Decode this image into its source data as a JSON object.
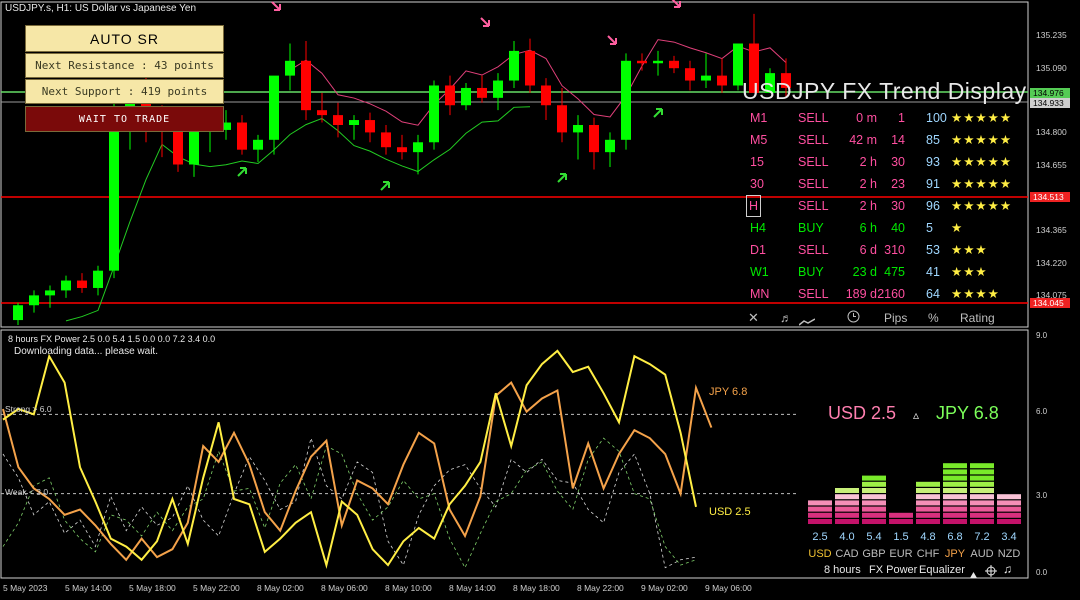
{
  "window": {
    "title": "USDJPY.s, H1:  US Dollar vs Japanese Yen"
  },
  "sr_panel": {
    "title": "AUTO SR",
    "resistance": "Next Resistance : 43 points",
    "support": "Next Support : 419 points",
    "status": "WAIT TO TRADE"
  },
  "price_axis": {
    "ticks": [
      "135.235",
      "135.090",
      "134.800",
      "134.655",
      "134.365",
      "134.220",
      "134.075"
    ],
    "bid": "134.976",
    "ask": "134.933",
    "support_level": "134.513",
    "low_level": "134.045"
  },
  "trend_display": {
    "title": "USDJPY FX Trend Display",
    "rows": [
      {
        "tf": "M1",
        "signal": "SELL",
        "time": "0 m",
        "pips": "1",
        "pct": "100",
        "stars": "★★★★★"
      },
      {
        "tf": "M5",
        "signal": "SELL",
        "time": "42 m",
        "pips": "14",
        "pct": "85",
        "stars": "★★★★★"
      },
      {
        "tf": "15",
        "signal": "SELL",
        "time": "2 h",
        "pips": "30",
        "pct": "93",
        "stars": "★★★★★"
      },
      {
        "tf": "30",
        "signal": "SELL",
        "time": "2 h",
        "pips": "23",
        "pct": "91",
        "stars": "★★★★★"
      },
      {
        "tf": "H",
        "signal": "SELL",
        "time": "2 h",
        "pips": "30",
        "pct": "96",
        "stars": "★★★★★"
      },
      {
        "tf": "H4",
        "signal": "BUY",
        "time": "6 h",
        "pips": "40",
        "pct": "5",
        "stars": "★"
      },
      {
        "tf": "D1",
        "signal": "SELL",
        "time": "6 d",
        "pips": "310",
        "pct": "53",
        "stars": "★★★"
      },
      {
        "tf": "W1",
        "signal": "BUY",
        "time": "23 d",
        "pips": "475",
        "pct": "41",
        "stars": "★★★"
      },
      {
        "tf": "MN",
        "signal": "SELL",
        "time": "189 d",
        "pips": "2160",
        "pct": "64",
        "stars": "★★★★"
      }
    ],
    "footer": {
      "close": "✕",
      "sound": "♬",
      "pips": "Pips",
      "percent": "%",
      "rating": "Rating"
    }
  },
  "power_panel": {
    "header": "8 hours FX Power 2.5 0.0 5.4 1.5 0.0 0.0 7.2 3.4 0.0",
    "status": "Downloading data... please wait.",
    "strong_label": "Strong > 6.0",
    "weak_label": "Weak < 3.0",
    "jpy_label": "JPY 6.8",
    "usd_label": "USD 2.5",
    "pair_usd": "USD 2.5",
    "pair_arrow": "▵",
    "pair_jpy": "JPY 6.8",
    "axis_ticks": [
      "9.0",
      "6.0",
      "3.0",
      "0.0"
    ]
  },
  "equalizer": {
    "currencies": [
      {
        "name": "USD",
        "value": "2.5",
        "level": 2.5,
        "name_color": "#f1c232"
      },
      {
        "name": "CAD",
        "value": "4.0",
        "level": 4.0,
        "name_color": "#bdbdbd"
      },
      {
        "name": "GBP",
        "value": "5.4",
        "level": 5.4,
        "name_color": "#bdbdbd"
      },
      {
        "name": "EUR",
        "value": "1.5",
        "level": 1.5,
        "name_color": "#bdbdbd"
      },
      {
        "name": "CHF",
        "value": "4.8",
        "level": 4.8,
        "name_color": "#bdbdbd"
      },
      {
        "name": "JPY",
        "value": "6.8",
        "level": 6.8,
        "name_color": "#f4a24a"
      },
      {
        "name": "AUD",
        "value": "7.2",
        "level": 7.2,
        "name_color": "#bdbdbd"
      },
      {
        "name": "NZD",
        "value": "3.4",
        "level": 3.4,
        "name_color": "#bdbdbd"
      }
    ],
    "footer_hours": "8 hours",
    "footer_power": "FX Power",
    "footer_eq": "Equalizer"
  },
  "time_axis": [
    "5 May 2023",
    "5 May 14:00",
    "5 May 18:00",
    "5 May 22:00",
    "8 May 02:00",
    "8 May 06:00",
    "8 May 10:00",
    "8 May 14:00",
    "8 May 18:00",
    "8 May 22:00",
    "9 May 02:00",
    "9 May 06:00"
  ],
  "colors": {
    "bull": "#00ff00",
    "bear": "#ff0000",
    "pink": "#ff4fa0",
    "sell": "#ff4fa0",
    "buy": "#00e800",
    "usd": "#ffee44",
    "jpy": "#f4a24a",
    "support": "#ff0000",
    "bidline": "#66dd66"
  },
  "chart_data": {
    "type": "candlestick",
    "timeframe": "H1",
    "symbol": "USDJPY.s",
    "ylim": [
      134.03,
      135.33
    ],
    "candles": [
      [
        134.05,
        134.12,
        134.03,
        134.11
      ],
      [
        134.11,
        134.17,
        134.08,
        134.15
      ],
      [
        134.15,
        134.19,
        134.1,
        134.17
      ],
      [
        134.17,
        134.23,
        134.14,
        134.21
      ],
      [
        134.21,
        134.24,
        134.16,
        134.18
      ],
      [
        134.18,
        134.27,
        134.15,
        134.25
      ],
      [
        134.25,
        134.93,
        134.22,
        134.88
      ],
      [
        134.88,
        134.99,
        134.74,
        134.94
      ],
      [
        134.94,
        135.05,
        134.77,
        134.86
      ],
      [
        134.86,
        134.92,
        134.71,
        134.82
      ],
      [
        134.82,
        134.86,
        134.65,
        134.68
      ],
      [
        134.68,
        134.83,
        134.63,
        134.82
      ],
      [
        134.82,
        134.86,
        134.73,
        134.82
      ],
      [
        134.82,
        134.9,
        134.78,
        134.85
      ],
      [
        134.85,
        134.88,
        134.72,
        134.74
      ],
      [
        134.74,
        134.8,
        134.69,
        134.78
      ],
      [
        134.78,
        134.95,
        134.72,
        135.04
      ],
      [
        135.04,
        135.17,
        134.98,
        135.1
      ],
      [
        135.1,
        135.18,
        134.86,
        134.9
      ],
      [
        134.9,
        134.97,
        134.85,
        134.88
      ],
      [
        134.88,
        134.93,
        134.79,
        134.84
      ],
      [
        134.84,
        134.88,
        134.78,
        134.86
      ],
      [
        134.86,
        134.89,
        134.77,
        134.81
      ],
      [
        134.81,
        134.84,
        134.72,
        134.75
      ],
      [
        134.75,
        134.8,
        134.7,
        134.73
      ],
      [
        134.73,
        134.8,
        134.64,
        134.77
      ],
      [
        134.77,
        135.02,
        134.74,
        135.0
      ],
      [
        135.0,
        135.04,
        134.88,
        134.92
      ],
      [
        134.92,
        135.01,
        134.9,
        134.99
      ],
      [
        134.99,
        135.04,
        134.93,
        134.95
      ],
      [
        134.95,
        135.05,
        134.9,
        135.02
      ],
      [
        135.02,
        135.18,
        134.99,
        135.14
      ],
      [
        135.14,
        135.19,
        134.97,
        135.0
      ],
      [
        135.0,
        135.03,
        134.86,
        134.92
      ],
      [
        134.92,
        134.99,
        134.77,
        134.81
      ],
      [
        134.81,
        134.88,
        134.7,
        134.84
      ],
      [
        134.84,
        134.87,
        134.66,
        134.73
      ],
      [
        134.73,
        134.81,
        134.67,
        134.78
      ],
      [
        134.78,
        135.13,
        134.74,
        135.1
      ],
      [
        135.1,
        135.13,
        135.06,
        135.09
      ],
      [
        135.09,
        135.14,
        135.04,
        135.1
      ],
      [
        135.1,
        135.12,
        135.05,
        135.07
      ],
      [
        135.07,
        135.1,
        134.98,
        135.02
      ],
      [
        135.02,
        135.13,
        134.99,
        135.04
      ],
      [
        135.04,
        135.11,
        134.97,
        135.0
      ],
      [
        135.0,
        135.15,
        134.98,
        135.17
      ],
      [
        135.17,
        135.29,
        135.05,
        134.97
      ],
      [
        134.97,
        135.07,
        134.98,
        135.05
      ],
      [
        135.05,
        135.11,
        134.95,
        134.99
      ]
    ]
  }
}
